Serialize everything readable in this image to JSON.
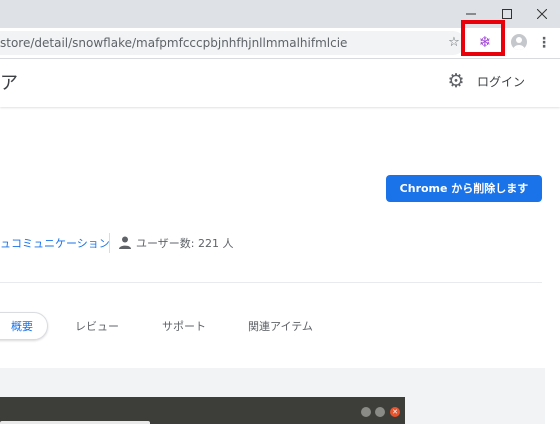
{
  "window": {
    "minimize_icon": "minimize-icon",
    "maximize_icon": "maximize-icon",
    "close_icon": "close-icon"
  },
  "toolbar": {
    "url": "store/detail/snowflake/mafpmfcccpbjnhfhjnllmmalhifmlcie",
    "bookmark_icon": "star-icon",
    "extension_icon": "snowflake-icon",
    "extension_color": "#a24ad9",
    "highlight_color": "#e8000a"
  },
  "header": {
    "title_fragment": "ア",
    "settings_icon": "gear-icon",
    "login_label": "ログイン"
  },
  "extension": {
    "remove_button": "Chrome から削除します",
    "category": "ュコミュニケーション",
    "users": "ユーザー数: 221 人",
    "accent_color": "#1a73e8"
  },
  "tabs": [
    {
      "label": "概要",
      "active": true
    },
    {
      "label": "レビュー",
      "active": false
    },
    {
      "label": "サポート",
      "active": false
    },
    {
      "label": "関連アイテム",
      "active": false
    }
  ]
}
